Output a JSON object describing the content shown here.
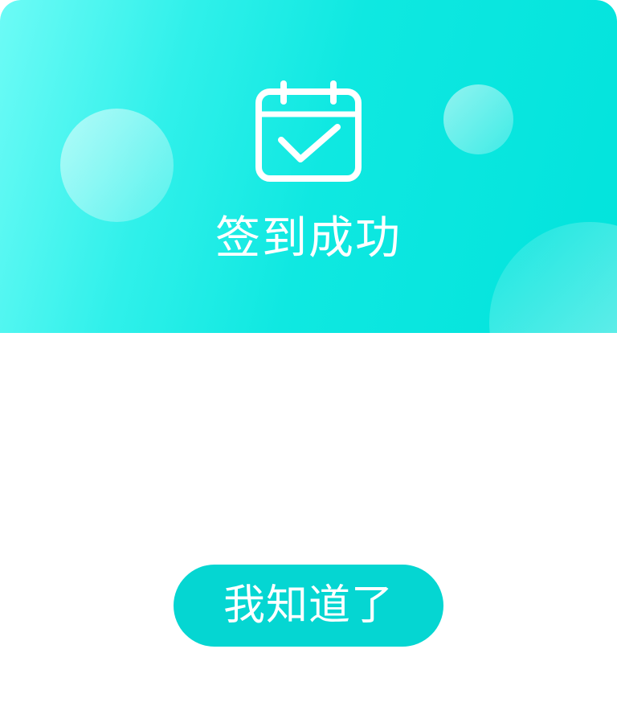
{
  "dialog": {
    "title": "签到成功",
    "icon": "calendar-check-icon",
    "confirm_label": "我知道了"
  },
  "colors": {
    "banner_gradient_start": "#6dfbf6",
    "banner_gradient_end": "#02e3dc",
    "button_background": "#05d6d2",
    "text": "#ffffff",
    "body_background": "#ffffff"
  }
}
